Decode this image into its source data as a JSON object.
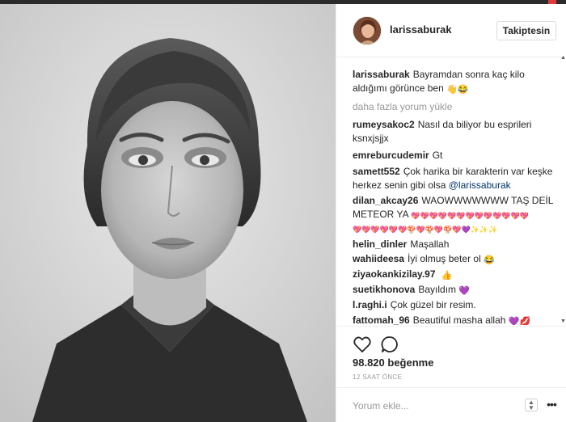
{
  "post": {
    "username": "larissaburak",
    "follow_label": "Takiptesin",
    "caption_user": "larissaburak",
    "caption_text": "Bayramdan sonra kaç kilo aldığımı görünce ben",
    "load_more": "daha fazla yorum yükle",
    "likes": "98.820 beğenme",
    "time": "12 SAAT ÖNCE",
    "comment_placeholder": "Yorum ekle..."
  },
  "comments": [
    {
      "user": "rumeysakoc2",
      "text": "Nasıl da biliyor bu esprileri ksnxjsjjx"
    },
    {
      "user": "emreburcudemir",
      "text": "Gt"
    },
    {
      "user": "samett552",
      "text": "Çok harika bir karakterin var keşke herkez senin gibi olsa",
      "mention": "@larissaburak"
    },
    {
      "user": "dilan_akcay26",
      "text": "WAOWWWWWWW TAŞ DEİL METEOR YA"
    },
    {
      "user": "helin_dinler",
      "text": "Maşallah"
    },
    {
      "user": "wahiideesa",
      "text": "İyi olmuş beter ol"
    },
    {
      "user": "ziyaokankizilay.97",
      "text": ""
    },
    {
      "user": "suetikhonova",
      "text": "Bayıldım"
    },
    {
      "user": "l.raghi.i",
      "text": "Çok güzel bir resim."
    },
    {
      "user": "fattomah_96",
      "text": "Beautiful masha allah"
    }
  ],
  "emoji": {
    "caption": "👋😂",
    "hearts_row1": "💖💖💖💖💖💖💖💖💖💖💖💖💖",
    "hearts_row2": "💖💖💖💖💖💖🍄💖🍄💖🍄💖💜✨✨✨",
    "wahiideesa": "😂",
    "ziyaokankizilay": "👍",
    "suetikhonova": "💜",
    "fattomah": "💜💋"
  },
  "icons": [
    "heart-icon",
    "comment-bubble-icon",
    "resize-icon",
    "more-icon"
  ]
}
